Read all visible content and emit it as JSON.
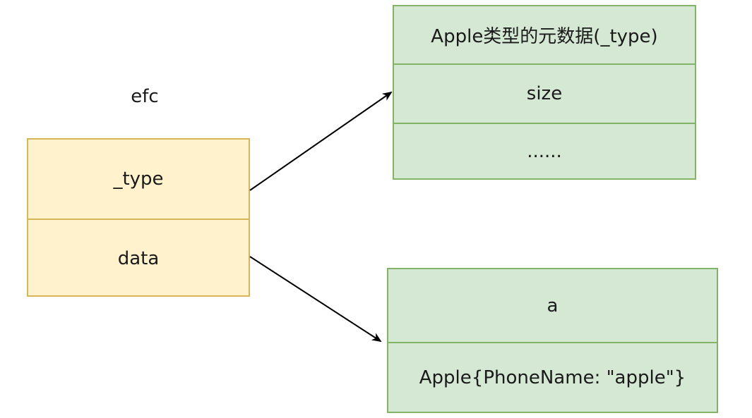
{
  "diagram": {
    "iface_label": "efc",
    "iface_fields": [
      "_type",
      "data"
    ],
    "type_box": {
      "rows": [
        "Apple类型的元数据(_type)",
        "size",
        "......"
      ]
    },
    "data_box": {
      "rows": [
        "a",
        "Apple{PhoneName: \"apple\"}"
      ]
    },
    "colors": {
      "iface_fill": "#fff2cc",
      "iface_stroke": "#d6b656",
      "green_fill": "#d5e8d4",
      "green_stroke": "#82b366",
      "arrow": "#000000"
    }
  }
}
